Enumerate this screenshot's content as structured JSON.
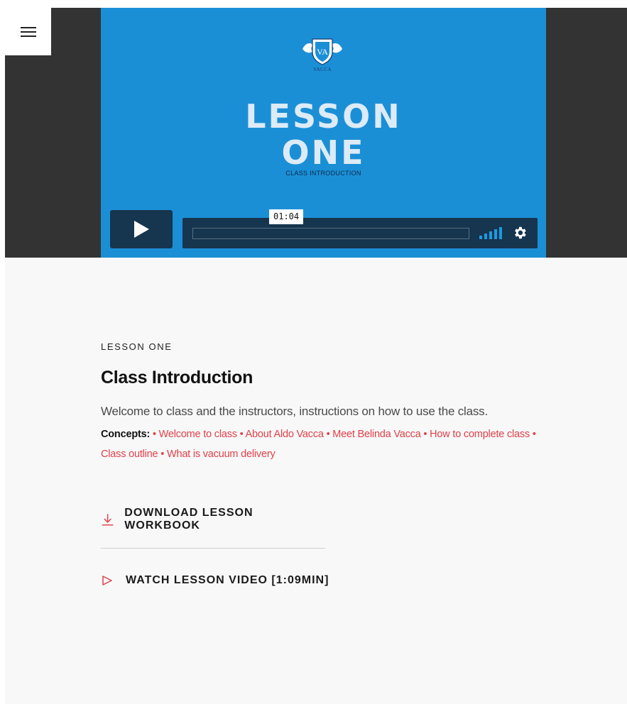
{
  "video": {
    "logo_text": "VACCA",
    "logo_monogram": "VA",
    "slide_title_line1": "LESSON",
    "slide_title_line2": "ONE",
    "slide_subtitle": "CLASS INTRODUCTION",
    "time_tooltip": "01:04",
    "progress": 0.0
  },
  "lesson": {
    "eyebrow": "LESSON ONE",
    "title": "Class Introduction",
    "description": "Welcome to class and the instructors, instructions on how to use the class.",
    "concepts_label": "Concepts:",
    "concepts": [
      "Welcome to class",
      "About Aldo Vacca",
      "Meet Belinda Vacca",
      "How to complete class",
      "Class outline",
      "What is vacuum delivery"
    ],
    "separator": " • "
  },
  "actions": {
    "download_label": "DOWNLOAD LESSON WORKBOOK",
    "watch_label": "WATCH LESSON VIDEO [1:09MIN]"
  },
  "colors": {
    "accent": "#e0404a",
    "player_blue": "#1b8fd6",
    "control_navy": "#16354e",
    "band_dark": "#333333",
    "volume_blue": "#1b9be0"
  },
  "icons": {
    "menu": "hamburger-icon",
    "play": "play-icon",
    "volume": "volume-bars-icon",
    "settings": "gear-icon",
    "download": "download-icon",
    "watch": "play-outline-icon",
    "logo": "crest-logo"
  }
}
